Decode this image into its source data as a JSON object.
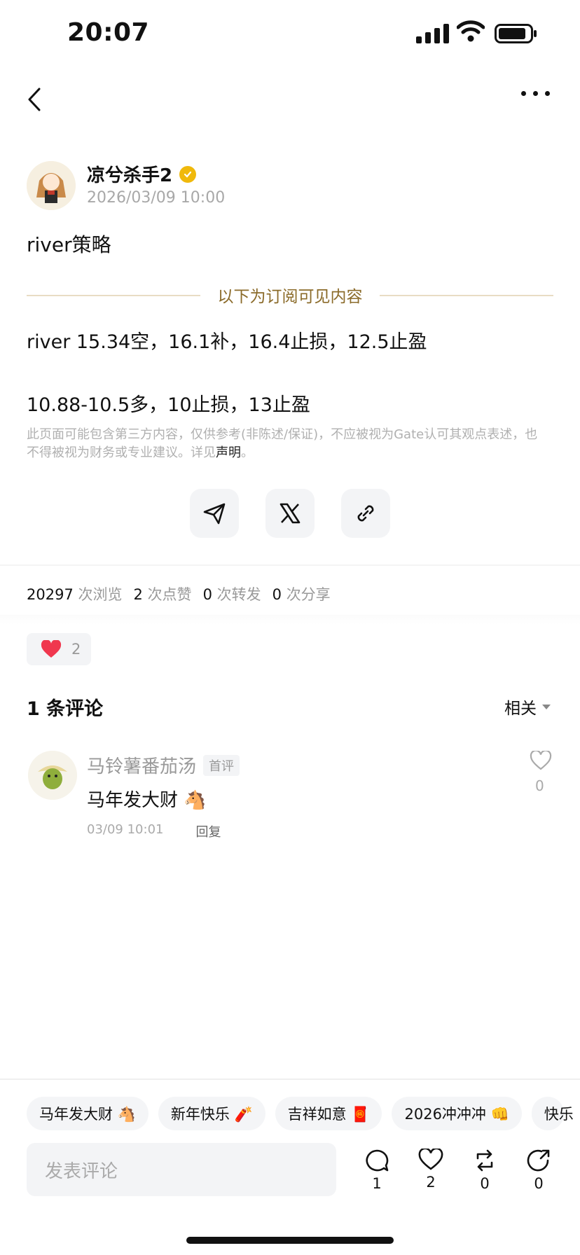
{
  "status_bar": {
    "time": "20:07"
  },
  "post": {
    "author": "凉兮杀手2",
    "timestamp": "2026/03/09 10:00",
    "title": "river策略",
    "subscription_label": "以下为订阅可见内容",
    "lines": [
      "river 15.34空，16.1补，16.4止损，12.5止盈",
      "10.88-10.5多，10止损，13止盈"
    ],
    "disclaimer": "此页面可能包含第三方内容，仅供参考(非陈述/保证)，不应被视为Gate认可其观点表述，也不得被视为财务或专业建议。详见",
    "disclaimer_link": "声明",
    "disclaimer_end": "。"
  },
  "stats": {
    "views": "20297",
    "views_unit": "次浏览",
    "likes": "2",
    "likes_unit": "次点赞",
    "reposts": "0",
    "reposts_unit": "次转发",
    "shares": "0",
    "shares_unit": "次分享"
  },
  "reaction": {
    "count": "2"
  },
  "comments": {
    "title": "1 条评论",
    "sort": "相关",
    "items": [
      {
        "name": "马铃薯番茄汤",
        "badge": "首评",
        "text": "马年发大财 🐴",
        "time": "03/09 10:01",
        "reply": "回复",
        "likes": "0"
      }
    ]
  },
  "quick_replies": [
    "马年发大财 🐴",
    "新年快乐 🧨",
    "吉祥如意 🧧",
    "2026冲冲冲 👊",
    "快乐"
  ],
  "input": {
    "placeholder": "发表评论"
  },
  "actions": {
    "comment": "1",
    "like": "2",
    "repost": "0",
    "share": "0"
  },
  "colors": {
    "accent_gold": "#f0b90b",
    "divider_gold": "#8b6b2a",
    "heart": "#f0374e"
  }
}
